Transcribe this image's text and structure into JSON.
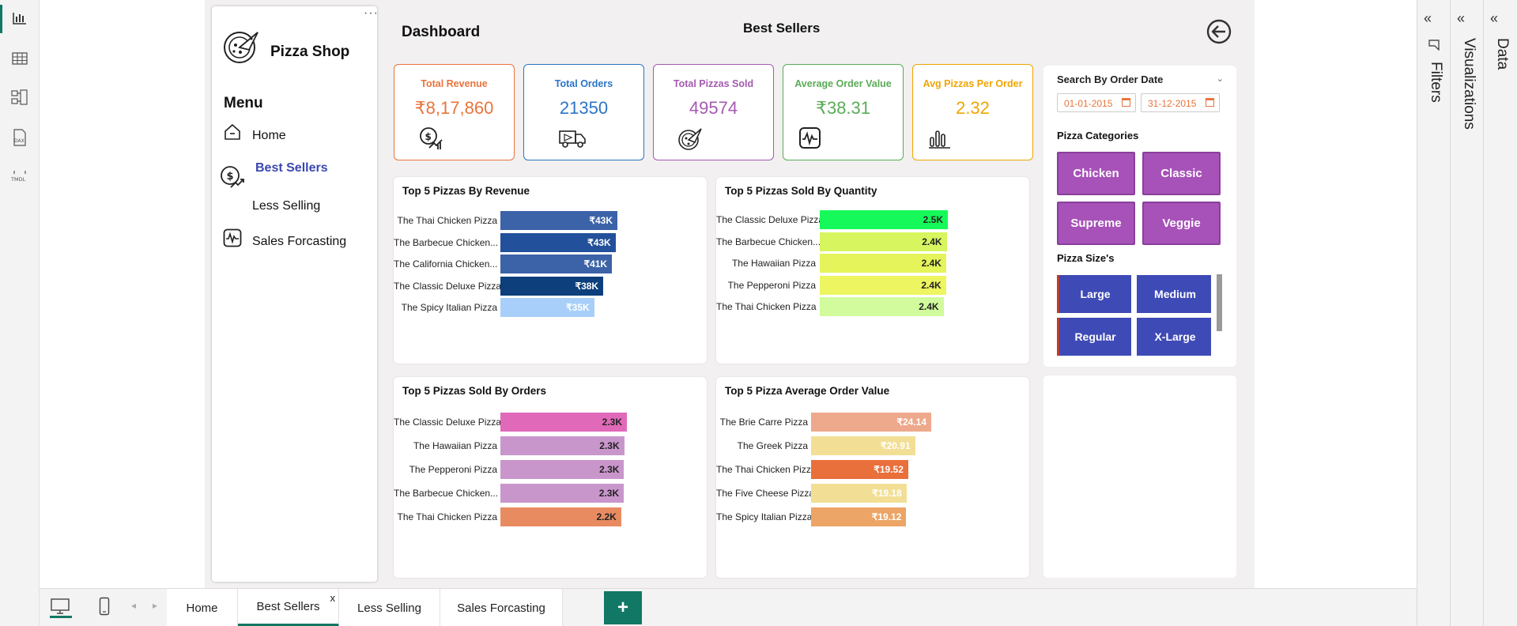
{
  "app": {
    "logo_text": "Pizza Shop",
    "menu_title": "Menu",
    "dashboard_title": "Dashboard",
    "page_heading": "Best Sellers"
  },
  "nav": {
    "home": "Home",
    "best_sellers": "Best Sellers",
    "less_selling": "Less Selling",
    "sales_forecasting": "Sales Forcasting"
  },
  "kpis": [
    {
      "label": "Total Revenue",
      "value": "₹8,17,860",
      "color": "#e8743b",
      "icon": "revenue-icon"
    },
    {
      "label": "Total Orders",
      "value": "21350",
      "color": "#2b74c7",
      "icon": "delivery-truck-icon"
    },
    {
      "label": "Total Pizzas Sold",
      "value": "49574",
      "color": "#a45ab0",
      "icon": "pizza-icon"
    },
    {
      "label": "Average Order Value",
      "value": "₹38.31",
      "color": "#5bab57",
      "icon": "pulse-icon"
    },
    {
      "label": "Avg Pizzas Per Order",
      "value": "2.32",
      "color": "#f0a500",
      "icon": "bar-chart-icon"
    }
  ],
  "charts": {
    "revenue": {
      "title": "Top 5 Pizzas By Revenue",
      "rows": [
        {
          "name": "The Thai Chicken Pizza",
          "label": "₹43K",
          "value": 43434,
          "color": "#3c62a8",
          "text": "#ffffff"
        },
        {
          "name": "The Barbecue Chicken...",
          "label": "₹43K",
          "value": 42768,
          "color": "#22509a",
          "text": "#ffffff"
        },
        {
          "name": "The California Chicken...",
          "label": "₹41K",
          "value": 41410,
          "color": "#3c62a8",
          "text": "#ffffff"
        },
        {
          "name": "The Classic Deluxe Pizza",
          "label": "₹38K",
          "value": 38180,
          "color": "#0d3f7c",
          "text": "#ffffff"
        },
        {
          "name": "The Spicy Italian Pizza",
          "label": "₹35K",
          "value": 34831,
          "color": "#a8cffa",
          "text": "#ffffff"
        }
      ]
    },
    "quantity": {
      "title": "Top 5 Pizzas Sold By Quantity",
      "rows": [
        {
          "name": "The Classic Deluxe Pizza",
          "label": "2.5K",
          "value": 2453,
          "color": "#15fa5a",
          "text": "#222222"
        },
        {
          "name": "The Barbecue Chicken...",
          "label": "2.4K",
          "value": 2432,
          "color": "#d7f55e",
          "text": "#222222"
        },
        {
          "name": "The Hawaiian Pizza",
          "label": "2.4K",
          "value": 2422,
          "color": "#e4f45a",
          "text": "#222222"
        },
        {
          "name": "The Pepperoni Pizza",
          "label": "2.4K",
          "value": 2418,
          "color": "#edf560",
          "text": "#222222"
        },
        {
          "name": "The Thai Chicken Pizza",
          "label": "2.4K",
          "value": 2371,
          "color": "#d1fb9c",
          "text": "#222222"
        }
      ]
    },
    "orders": {
      "title": "Top 5 Pizzas Sold By Orders",
      "rows": [
        {
          "name": "The Classic Deluxe Pizza",
          "label": "2.3K",
          "value": 2329,
          "color": "#e169b9",
          "text": "#222222"
        },
        {
          "name": "The Hawaiian Pizza",
          "label": "2.3K",
          "value": 2280,
          "color": "#c996cc",
          "text": "#222222"
        },
        {
          "name": "The Pepperoni Pizza",
          "label": "2.3K",
          "value": 2278,
          "color": "#c996cc",
          "text": "#222222"
        },
        {
          "name": "The Barbecue Chicken...",
          "label": "2.3K",
          "value": 2273,
          "color": "#c996cc",
          "text": "#222222"
        },
        {
          "name": "The Thai Chicken Pizza",
          "label": "2.2K",
          "value": 2225,
          "color": "#e98b61",
          "text": "#222222"
        }
      ]
    },
    "aov": {
      "title": "Top 5 Pizza Average Order Value",
      "rows": [
        {
          "name": "The Brie Carre Pizza",
          "label": "₹24.14",
          "value": 24.14,
          "color": "#eea88b",
          "text": "#ffffff"
        },
        {
          "name": "The Greek Pizza",
          "label": "₹20.91",
          "value": 20.91,
          "color": "#f2df95",
          "text": "#ffffff"
        },
        {
          "name": "The Thai Chicken Pizza",
          "label": "₹19.52",
          "value": 19.52,
          "color": "#e96f3b",
          "text": "#ffffff"
        },
        {
          "name": "The Five Cheese Pizza",
          "label": "₹19.18",
          "value": 19.18,
          "color": "#f2df95",
          "text": "#ffffff"
        },
        {
          "name": "The Spicy Italian Pizza",
          "label": "₹19.12",
          "value": 19.12,
          "color": "#eca566",
          "text": "#ffffff"
        }
      ]
    }
  },
  "filters": {
    "date_title": "Search By Order Date",
    "start_date": "01-01-2015",
    "end_date": "31-12-2015",
    "categories_title": "Pizza Categories",
    "categories": [
      "Chicken",
      "Classic",
      "Supreme",
      "Veggie"
    ],
    "sizes_title": "Pizza Size's",
    "sizes": [
      "Large",
      "Medium",
      "Regular",
      "X-Large"
    ]
  },
  "panes": {
    "filters": "Filters",
    "visualizations": "Visualizations",
    "data": "Data"
  },
  "tabs": [
    "Home",
    "Best Sellers",
    "Less Selling",
    "Sales Forcasting"
  ],
  "rail_icons": [
    "report-view-icon",
    "table-view-icon",
    "model-view-icon",
    "dax-query-icon",
    "tmdl-view-icon"
  ]
}
